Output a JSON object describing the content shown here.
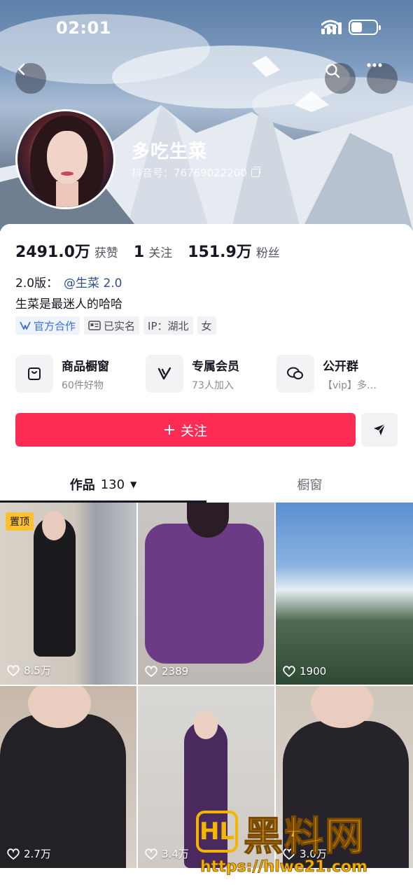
{
  "status_bar": {
    "time": "02:01"
  },
  "profile": {
    "nickname": "多吃生菜",
    "douyin_id": "抖音号：76769022200",
    "stats": [
      {
        "value": "2491.0万",
        "label": "获赞"
      },
      {
        "value": "1",
        "label": "关注"
      },
      {
        "value": "151.9万",
        "label": "粉丝"
      }
    ],
    "bio_prefix": "2.0版：",
    "bio_mention": "@生菜 2.0",
    "bio_line2": "生菜是最迷人的哈哈",
    "tags": [
      {
        "label": "官方合作",
        "icon": "official-icon"
      },
      {
        "label": "已实名",
        "icon": "id-card-icon"
      },
      {
        "label": "IP：湖北",
        "icon": ""
      },
      {
        "label": "女",
        "icon": ""
      }
    ]
  },
  "services": [
    {
      "title": "商品橱窗",
      "subtitle": "60件好物",
      "icon": "shop-bag-icon"
    },
    {
      "title": "专属会员",
      "subtitle": "73人加入",
      "icon": "vip-v-icon"
    },
    {
      "title": "公开群",
      "subtitle": "【vip】多…",
      "icon": "group-chat-icon"
    }
  ],
  "actions": {
    "follow_label": "关注",
    "follow_icon": "plus-icon"
  },
  "tabs": {
    "works_label": "作品",
    "works_count": "130",
    "showcase_label": "橱窗"
  },
  "videos": [
    {
      "likes": "8.5万",
      "pinned": "置顶"
    },
    {
      "likes": "2389"
    },
    {
      "likes": "1900"
    },
    {
      "likes": "2.7万"
    },
    {
      "likes": "3.4万"
    },
    {
      "likes": "3.0万"
    }
  ],
  "watermark": {
    "logo": "HL",
    "title": "黑料网",
    "url": "https://hlwe21.com"
  },
  "colors": {
    "accent": "#fe2c55",
    "mention": "#2d4f8a",
    "pin": "#fcc12d"
  }
}
